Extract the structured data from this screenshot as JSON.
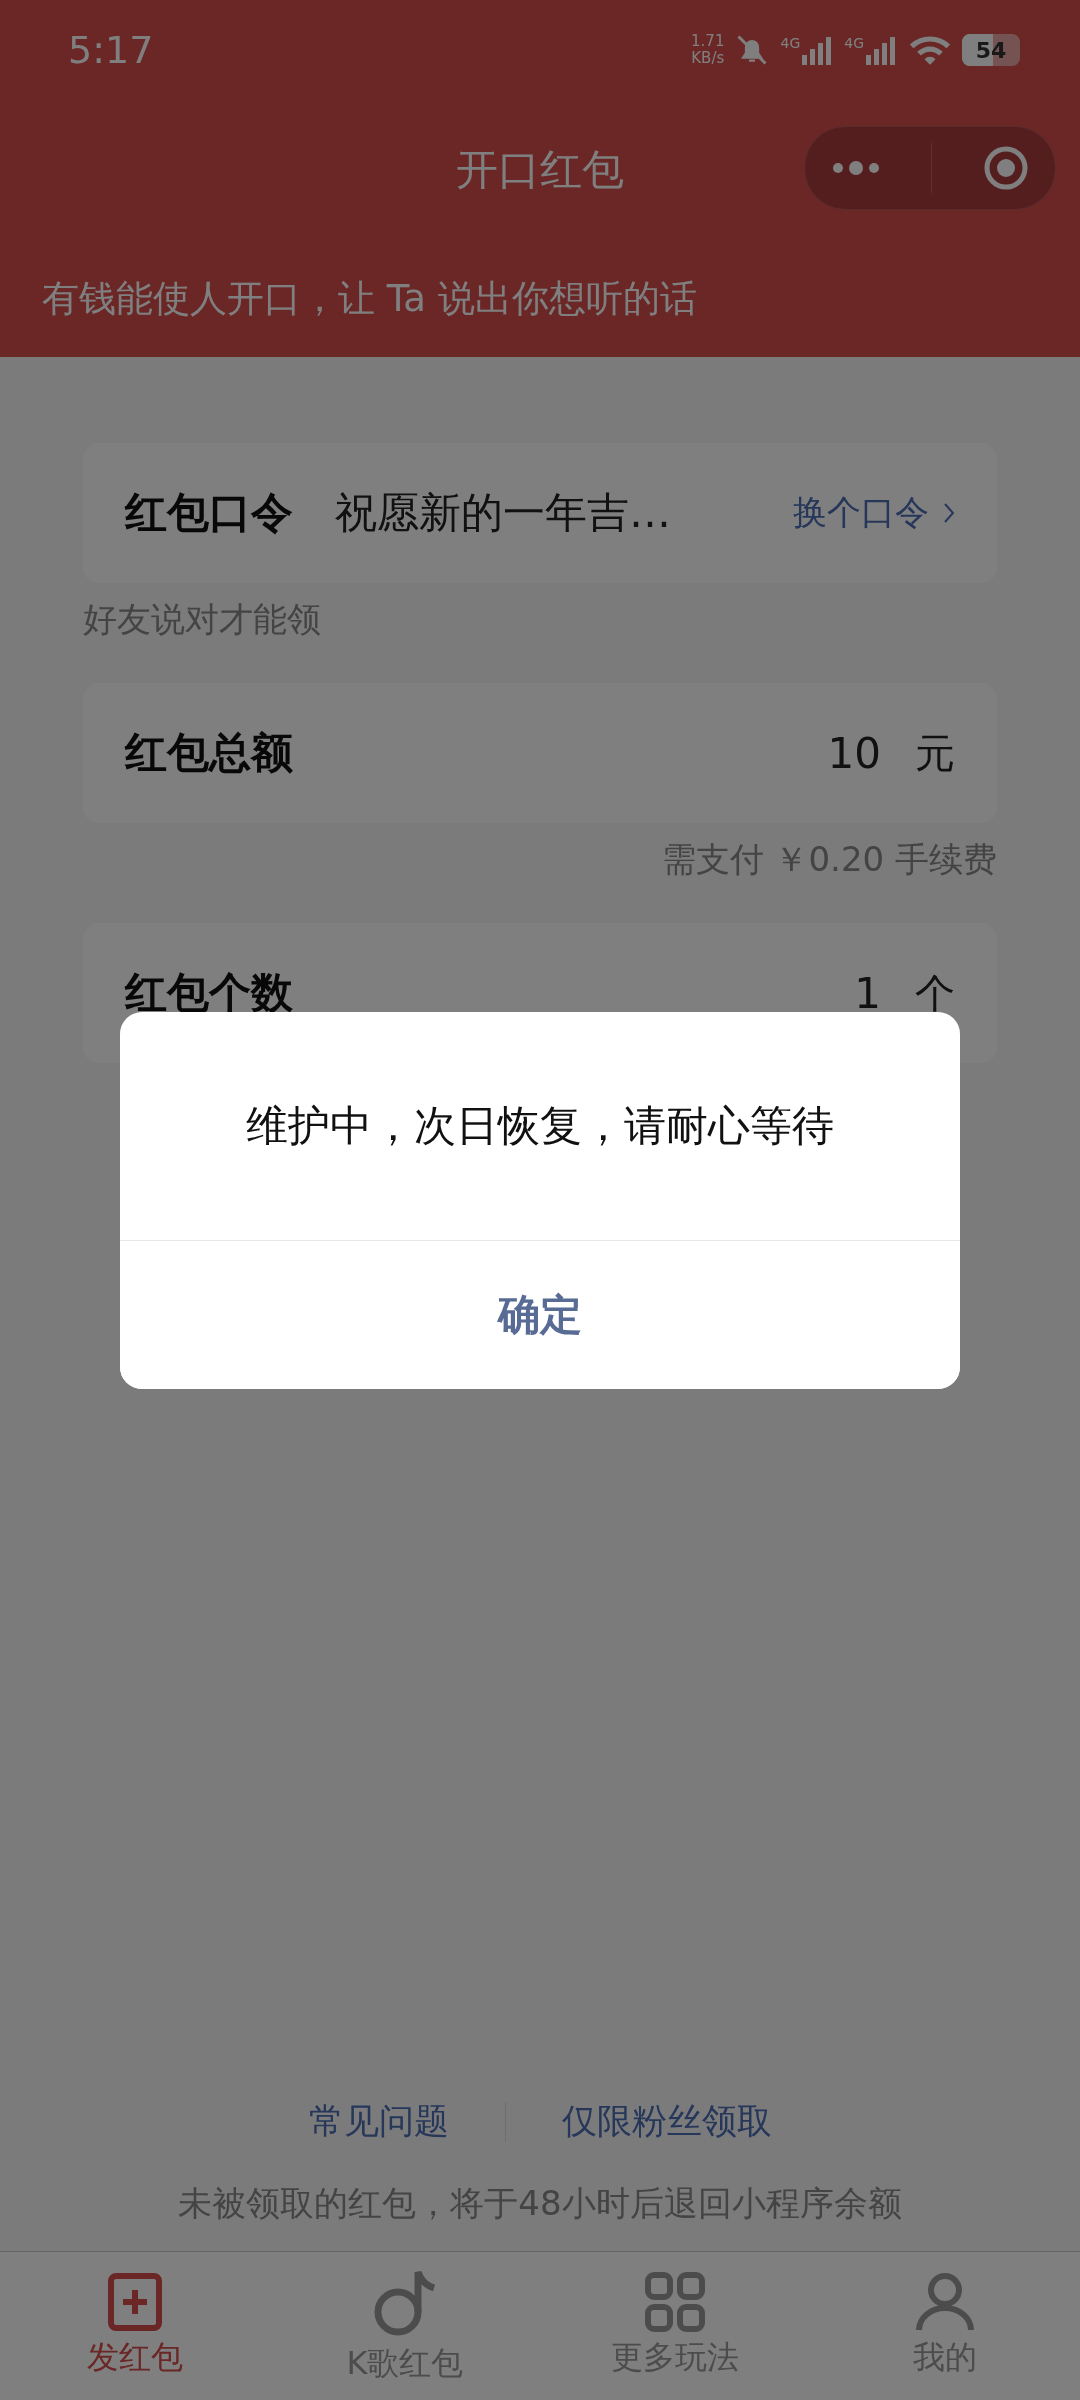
{
  "status_bar": {
    "time": "5:17",
    "speed": "1.71",
    "speed_unit": "KB/s",
    "network_1": "4G",
    "network_2": "4G",
    "battery": "54"
  },
  "title_bar": {
    "title": "开口红包"
  },
  "banner": {
    "text": "有钱能使人开口，让 Ta 说出你想听的话"
  },
  "form": [
    {
      "label": "红包口令",
      "value": "祝愿新的一年吉…",
      "action": "换个口令",
      "note": "好友说对才能领"
    },
    {
      "label": "红包总额",
      "value": "10",
      "unit": "元",
      "note": "需支付 ￥0.20 手续费"
    },
    {
      "label": "红包个数",
      "value": "1",
      "unit": "个"
    }
  ],
  "footer": {
    "links": [
      "常见问题",
      "仅限粉丝领取"
    ],
    "note": "未被领取的红包，将于48小时后退回小程序余额"
  },
  "tab_bar": [
    {
      "label": "发红包",
      "kind": "add",
      "selected": true
    },
    {
      "label": "K歌红包",
      "kind": "music",
      "selected": false
    },
    {
      "label": "更多玩法",
      "kind": "grid",
      "selected": false
    },
    {
      "label": "我的",
      "kind": "person",
      "selected": false
    }
  ],
  "dialog": {
    "message": "维护中，次日恢复，请耐心等待",
    "button": "确定"
  }
}
